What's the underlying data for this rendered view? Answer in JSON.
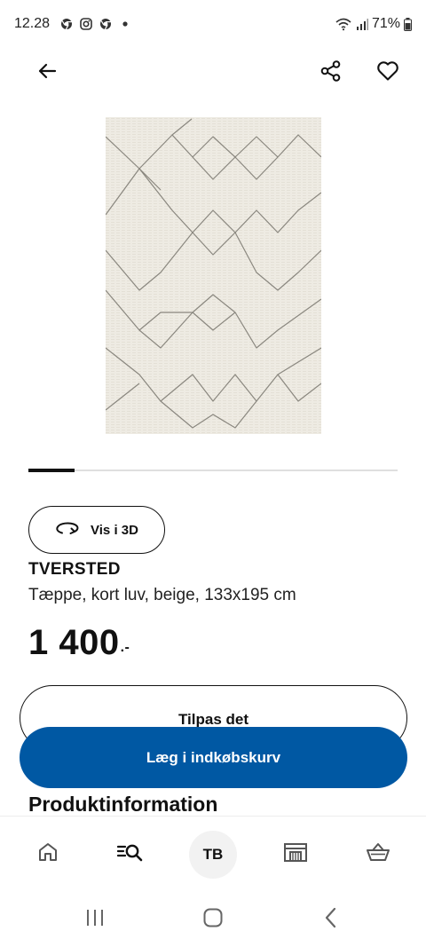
{
  "status_bar": {
    "time": "12.28",
    "left_icons": [
      "chrome-icon",
      "instagram-icon",
      "chrome-icon",
      "notification-dot-icon"
    ],
    "right_icons": [
      "wifi-icon",
      "signal-icon"
    ],
    "battery": "71%"
  },
  "top_bar": {
    "back_icon": "arrow-left-icon",
    "share_icon": "share-icon",
    "favorite_icon": "heart-icon"
  },
  "product": {
    "image_icon": "rug-image",
    "carousel_progress": 0.125,
    "view_3d_label": "Vis i 3D",
    "name": "TVERSTED",
    "description": "Tæppe, kort luv, beige, 133x195 cm",
    "price_main": "1 400",
    "price_decimal": ".-"
  },
  "actions": {
    "customize_label": "Tilpas det",
    "add_to_cart_label": "Læg i indkøbskurv",
    "add_to_cart_color": "#0058a3"
  },
  "section": {
    "heading": "Produktinformation"
  },
  "bottom_nav": {
    "items": [
      {
        "icon": "home-icon"
      },
      {
        "icon": "search-icon"
      },
      {
        "icon": "avatar",
        "label": "TB"
      },
      {
        "icon": "store-icon"
      },
      {
        "icon": "basket-icon"
      }
    ]
  },
  "system_nav": {
    "icons": [
      "recent-apps-icon",
      "home-button-icon",
      "back-icon"
    ]
  }
}
